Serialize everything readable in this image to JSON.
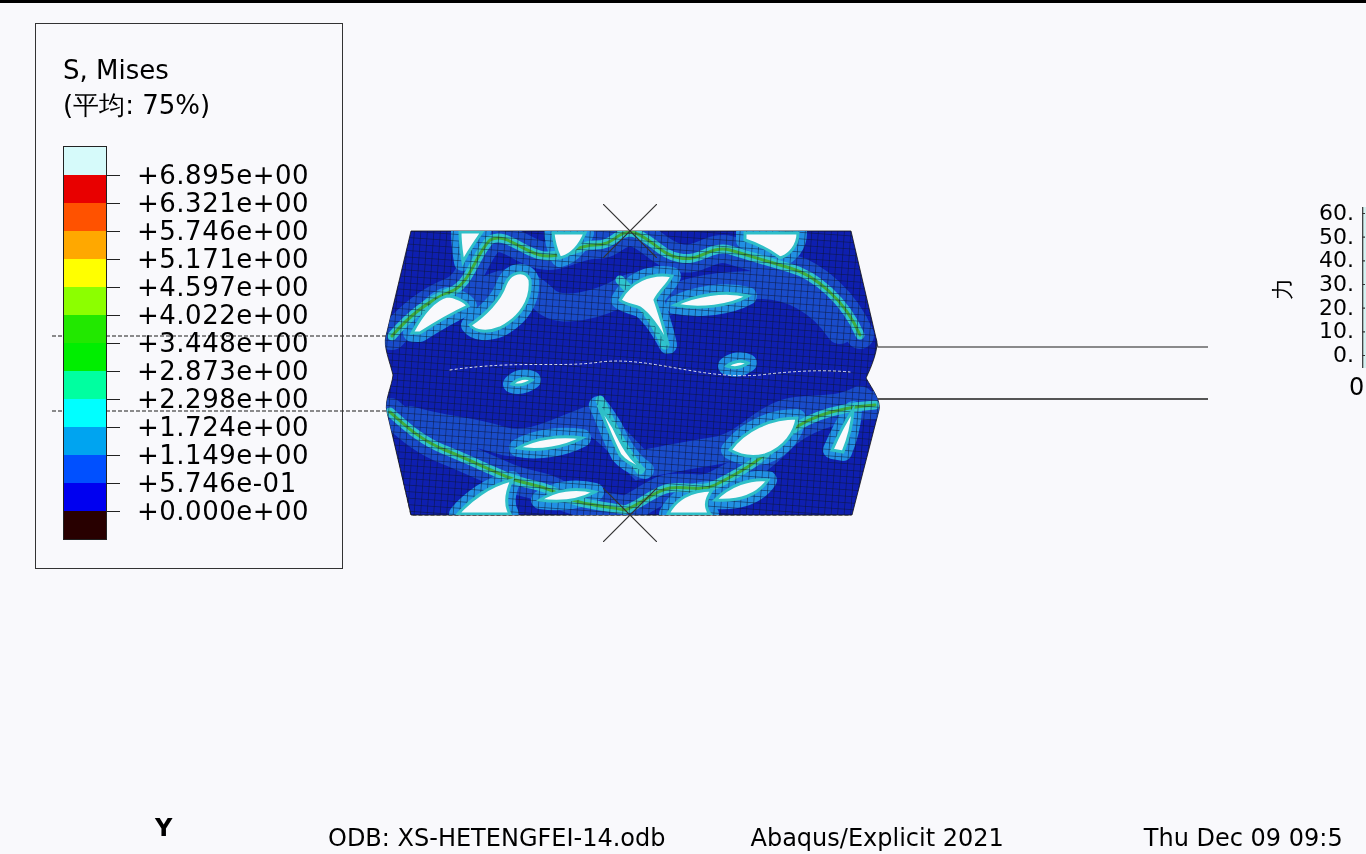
{
  "legend": {
    "title": "S, Mises",
    "subtitle": "(平均: 75%)",
    "bands": [
      {
        "color": "#d6fafa"
      },
      {
        "color": "#e80000"
      },
      {
        "color": "#ff5200"
      },
      {
        "color": "#ffa800"
      },
      {
        "color": "#ffff00"
      },
      {
        "color": "#8cff00"
      },
      {
        "color": "#22e800"
      },
      {
        "color": "#00ee00"
      },
      {
        "color": "#00ffa0"
      },
      {
        "color": "#00ffff"
      },
      {
        "color": "#00a4f0"
      },
      {
        "color": "#0050ff"
      },
      {
        "color": "#0000f0"
      },
      {
        "color": "#280000"
      }
    ],
    "labels": [
      "+6.895e+00",
      "+6.321e+00",
      "+5.746e+00",
      "+5.171e+00",
      "+4.597e+00",
      "+4.022e+00",
      "+3.448e+00",
      "+2.873e+00",
      "+2.298e+00",
      "+1.724e+00",
      "+1.149e+00",
      "+5.746e-01",
      "+0.000e+00"
    ]
  },
  "xy_plot": {
    "y_axis_label": "力",
    "y_tick_labels": [
      "60.",
      "50.",
      "40.",
      "30.",
      "20.",
      "10.",
      "0."
    ],
    "x_tick_label": "0"
  },
  "triad": {
    "axis_label": "Y"
  },
  "title_block": [
    "ODB: XS-HETENGFEI-14.odb",
    "Abaqus/Explicit 2021",
    "Thu Dec 09 09:5"
  ]
}
